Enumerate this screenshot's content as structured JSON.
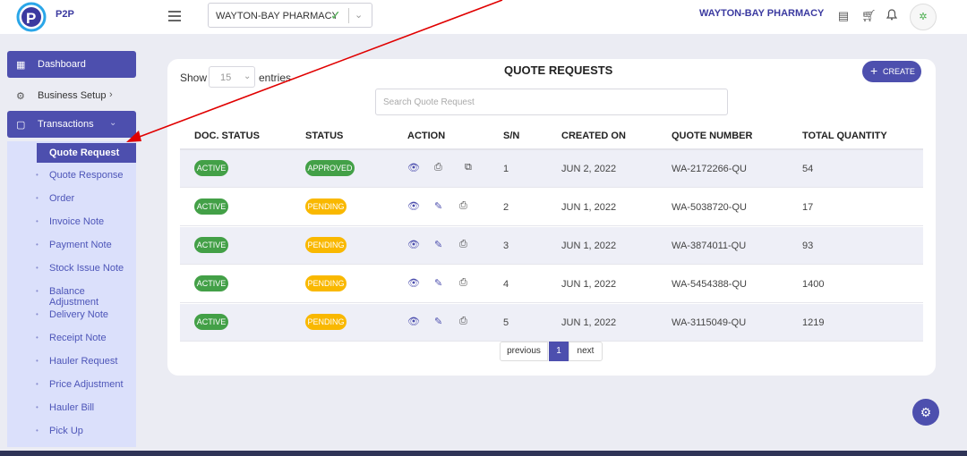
{
  "header": {
    "logo_text": "P2P",
    "store_select": "WAYTON-BAY PHARMACY",
    "brand_name": "WAYTON-BAY PHARMACY"
  },
  "sidebar": {
    "dashboard": "Dashboard",
    "business_setup": "Business Setup",
    "transactions": "Transactions",
    "items": [
      {
        "label": "Quote Request",
        "active": true
      },
      {
        "label": "Quote Response"
      },
      {
        "label": "Order"
      },
      {
        "label": "Invoice Note"
      },
      {
        "label": "Payment Note"
      },
      {
        "label": "Stock Issue Note"
      },
      {
        "label": "Balance Adjustment"
      },
      {
        "label": "Delivery Note"
      },
      {
        "label": "Receipt Note"
      },
      {
        "label": "Hauler Request"
      },
      {
        "label": "Price Adjustment"
      },
      {
        "label": "Hauler Bill"
      },
      {
        "label": "Pick Up"
      }
    ]
  },
  "main": {
    "title": "QUOTE REQUESTS",
    "show_label": "Show",
    "entries_value": "15",
    "entries_label": "entries",
    "create_label": "CREATE",
    "search_placeholder": "Search Quote Request",
    "columns": [
      "DOC. STATUS",
      "STATUS",
      "ACTION",
      "S/N",
      "CREATED ON",
      "QUOTE NUMBER",
      "TOTAL QUANTITY"
    ],
    "rows": [
      {
        "doc_status": "ACTIVE",
        "status": "APPROVED",
        "sn": "1",
        "created_on": "JUN 2, 2022",
        "quote_number": "WA-2172266-QU",
        "total_quantity": "54"
      },
      {
        "doc_status": "ACTIVE",
        "status": "PENDING",
        "sn": "2",
        "created_on": "JUN 1, 2022",
        "quote_number": "WA-5038720-QU",
        "total_quantity": "17"
      },
      {
        "doc_status": "ACTIVE",
        "status": "PENDING",
        "sn": "3",
        "created_on": "JUN 1, 2022",
        "quote_number": "WA-3874011-QU",
        "total_quantity": "93"
      },
      {
        "doc_status": "ACTIVE",
        "status": "PENDING",
        "sn": "4",
        "created_on": "JUN 1, 2022",
        "quote_number": "WA-5454388-QU",
        "total_quantity": "1400"
      },
      {
        "doc_status": "ACTIVE",
        "status": "PENDING",
        "sn": "5",
        "created_on": "JUN 1, 2022",
        "quote_number": "WA-3115049-QU",
        "total_quantity": "1219"
      }
    ],
    "pagination": {
      "previous": "previous",
      "current": "1",
      "next": "next"
    }
  },
  "colors": {
    "accent": "#4d4fae",
    "success": "#43a047",
    "pending": "#f9b800",
    "annotation_arrow": "#e00000"
  },
  "icons": [
    "hamburger-icon",
    "check-icon",
    "chevron-down-icon",
    "list-icon",
    "cart-icon",
    "bell-icon",
    "avatar",
    "grid-icon",
    "gear-icon",
    "document-icon",
    "eye-icon",
    "print-icon",
    "copy-icon",
    "edit-icon",
    "plus-icon"
  ]
}
